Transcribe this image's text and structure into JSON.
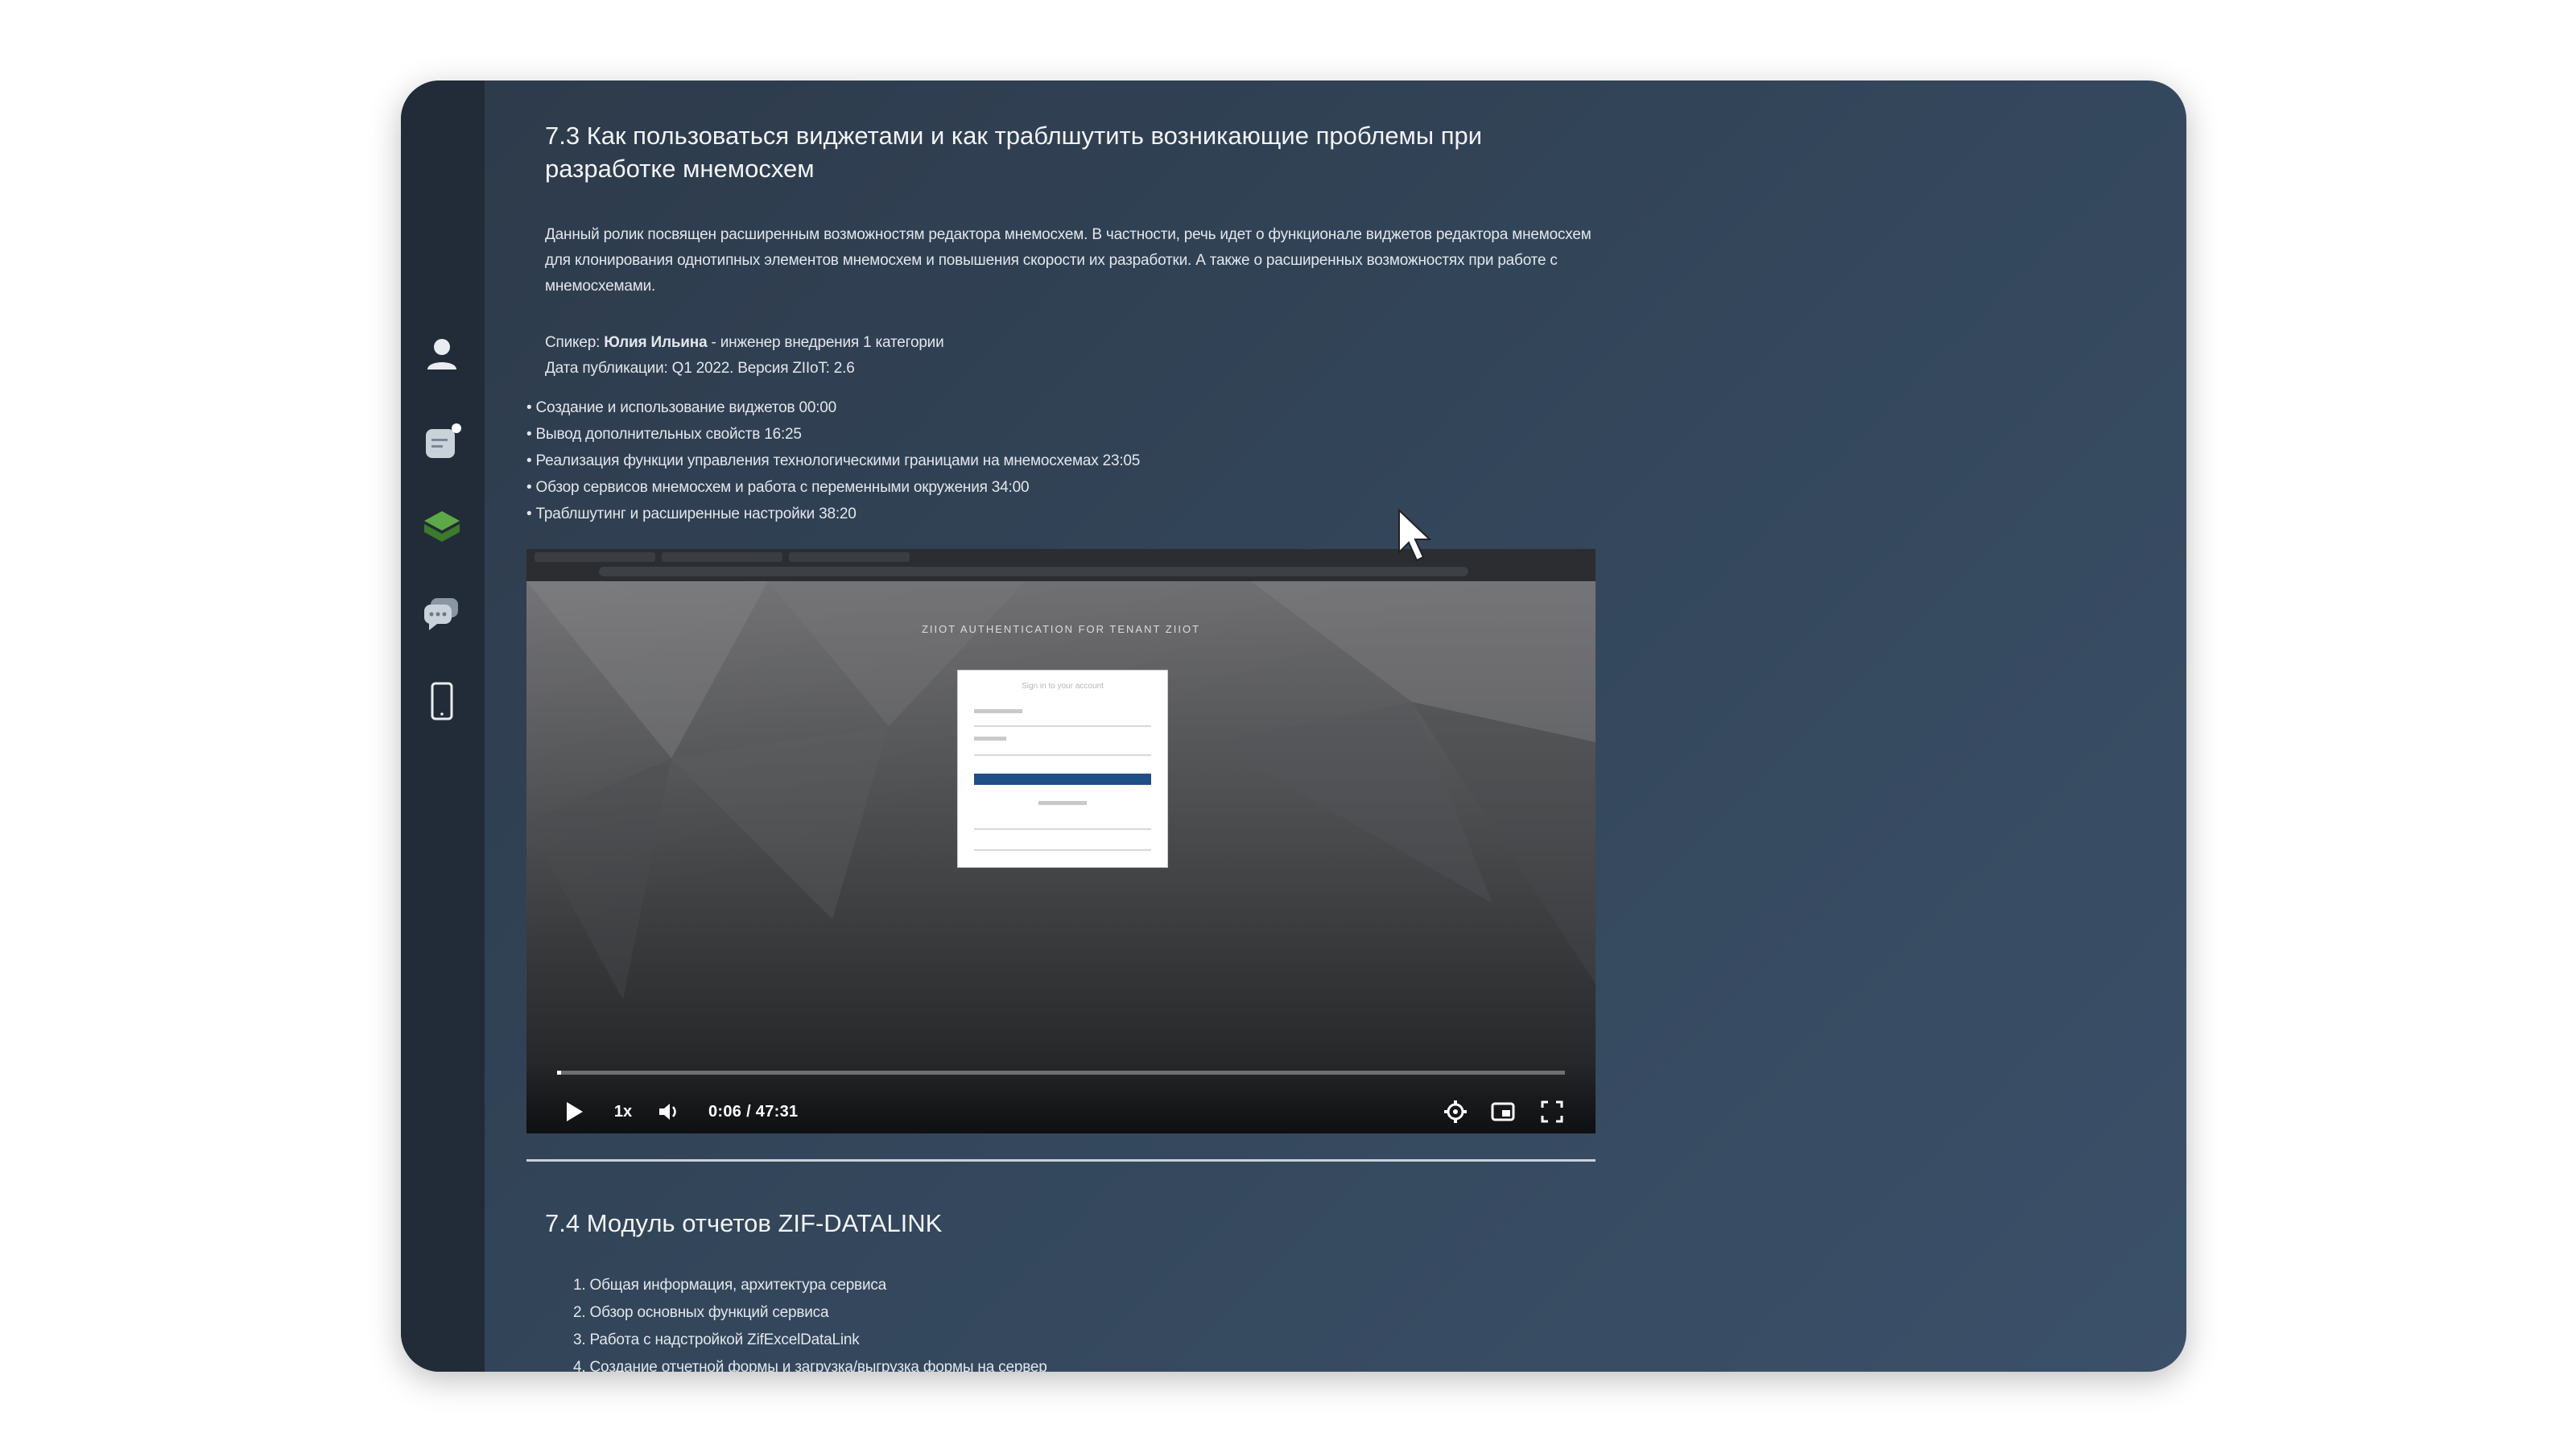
{
  "section_73": {
    "title": "7.3 Как пользоваться виджетами и как траблшутить возникающие проблемы при разработке мнемосхем",
    "description": "Данный ролик посвящен расширенным возможностям редактора мнемосхем. В частности, речь идет о функционале виджетов редактора мнемосхем для клонирования однотипных элементов мнемосхем и повышения скорости их разработки. А также о расширенных возможностях при работе с мнемосхемами.",
    "speaker_label": "Спикер:",
    "speaker_name": "Юлия Ильина",
    "speaker_role": "- инженер внедрения 1 категории",
    "publish_date": "Дата публикации: Q1 2022. Версия ZIIoT: 2.6",
    "chapters": [
      "• Создание и использование виджетов 00:00",
      "• Вывод дополнительных свойств 16:25",
      "• Реализация функции управления технологическими границами на мнемосхемах 23:05",
      "• Обзор сервисов мнемосхем и работа с переменными окружения 34:00",
      "• Траблшутинг и расширенные настройки 38:20"
    ]
  },
  "video": {
    "auth_title": "ZIIOT AUTHENTICATION FOR TENANT ZIIOT",
    "login_card_title": "Sign in to your account",
    "speed": "1x",
    "time": "0:06 / 47:31",
    "progress": 0.002
  },
  "section_74": {
    "title": "7.4 Модуль отчетов ZIF-DATALINK",
    "items": [
      "1. Общая информация, архитектура сервиса",
      "2. Обзор основных функций сервиса",
      "3. Работа с надстройкой ZifExcelDataLink",
      "4. Создание отчетной формы и загрузка/выгрузка формы на сервер"
    ]
  },
  "sidebar": {
    "icons": [
      "user-icon",
      "notes-icon",
      "layers-icon",
      "chat-icon",
      "phone-icon"
    ]
  },
  "colors": {
    "sidebar": "#222c38",
    "content_bg": "#34475c",
    "active_icon": "#4f9a3a"
  }
}
